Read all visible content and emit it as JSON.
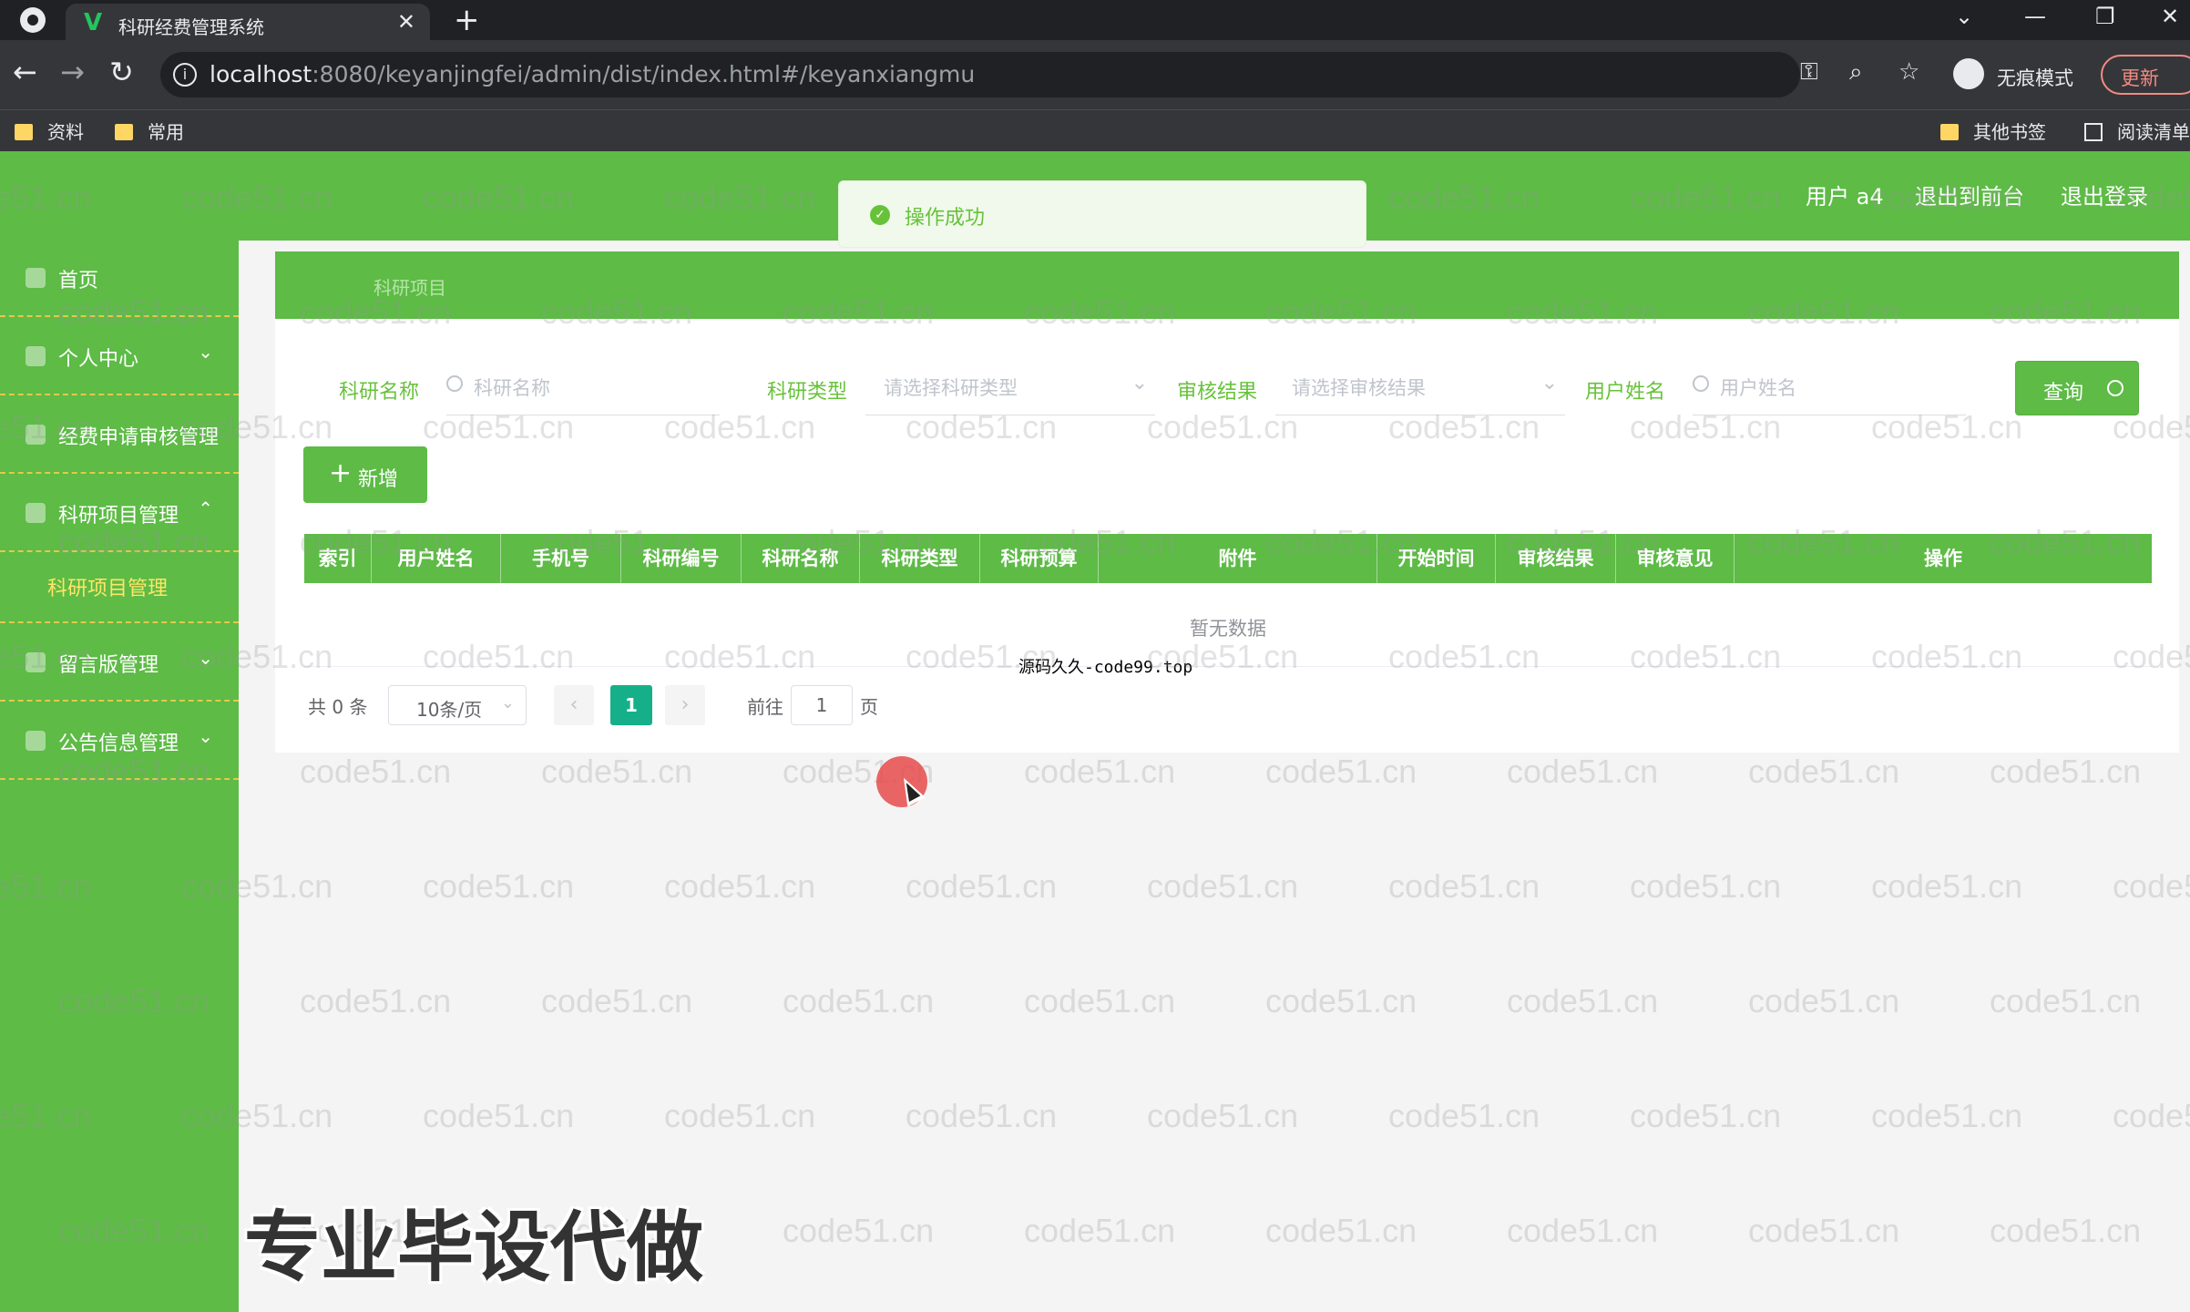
{
  "browser": {
    "tab_title": "科研经费管理系统",
    "url_host": "localhost",
    "url_rest": ":8080/keyanjingfei/admin/dist/index.html#/keyanxiangmu",
    "incognito_label": "无痕模式",
    "update_label": "更新",
    "bookmarks": [
      "资料",
      "常用"
    ],
    "other_bookmarks": "其他书签",
    "reading_list": "阅读清单"
  },
  "header": {
    "user_label": "用户 a4",
    "to_front_label": "退出到前台",
    "logout_label": "退出登录"
  },
  "toast": {
    "message": "操作成功"
  },
  "sidebar": {
    "items": [
      {
        "label": "首页",
        "arrow": ""
      },
      {
        "label": "个人中心",
        "arrow": "⌄"
      },
      {
        "label": "经费申请审核管理",
        "arrow": ""
      },
      {
        "label": "科研项目管理",
        "arrow": "⌃"
      },
      {
        "label": "留言版管理",
        "arrow": "⌄"
      },
      {
        "label": "公告信息管理",
        "arrow": "⌄"
      }
    ],
    "active_sub": "科研项目管理"
  },
  "breadcrumb": "科研项目",
  "search": {
    "name_label": "科研名称",
    "name_placeholder": "科研名称",
    "type_label": "科研类型",
    "type_placeholder": "请选择科研类型",
    "audit_label": "审核结果",
    "audit_placeholder": "请选择审核结果",
    "user_label": "用户姓名",
    "user_placeholder": "用户姓名",
    "query_label": "查询"
  },
  "actions": {
    "add_label": "新增"
  },
  "table": {
    "columns": [
      "索引",
      "用户姓名",
      "手机号",
      "科研编号",
      "科研名称",
      "科研类型",
      "科研预算",
      "附件",
      "开始时间",
      "审核结果",
      "审核意见",
      "操作"
    ],
    "empty_text": "暂无数据"
  },
  "overlay_text": "源码久久-code99.top",
  "pagination": {
    "total": "共 0 条",
    "page_size": "10条/页",
    "current_page": "1",
    "goto_label": "前往",
    "goto_value": "1",
    "page_suffix": "页"
  },
  "watermark": "code51.cn",
  "promo_text": "专业毕设代做",
  "colors": {
    "primary": "#5dbb46",
    "active_menu": "#ffe566",
    "pager_active": "#15b08a"
  }
}
